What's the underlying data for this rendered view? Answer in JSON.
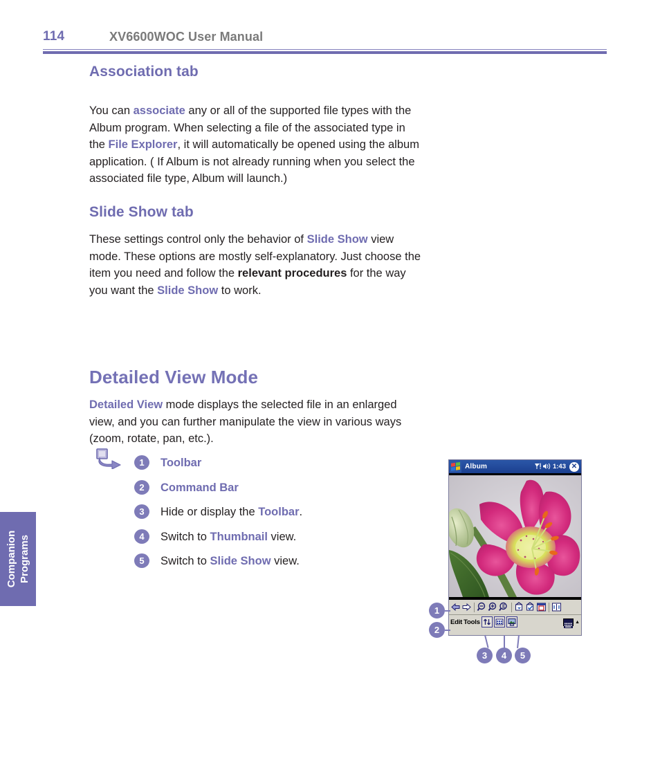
{
  "header": {
    "page_number": "114",
    "manual_title": "XV6600WOC User Manual"
  },
  "side_tab": {
    "line1": "Companion",
    "line2": "Programs"
  },
  "sections": {
    "association": {
      "heading": "Association tab",
      "paragraph": {
        "t1": "You can ",
        "hl1": "associate",
        "t2": " any or all of the supported file types with the Album program. When selecting a file of the associated type in the ",
        "hl2": "File Explorer",
        "t3": ", it will automatically be opened using the album application. ( If Album is not already running when you select the associated file type, Album will launch.)"
      }
    },
    "slide_show": {
      "heading": "Slide Show tab",
      "paragraph": {
        "t1": "These settings control only the behavior of ",
        "hl1": "Slide Show",
        "t2": " view mode. These options are mostly self-explanatory. Just choose the item you need and follow the ",
        "bk1": "relevant procedures",
        "t3": " for the way you want the ",
        "hl2": "Slide Show",
        "t4": " to work."
      }
    },
    "detailed_view": {
      "heading": "Detailed View Mode",
      "paragraph": {
        "hl1": "Detailed View",
        "t1": " mode displays the selected file in an enlarged view, and you can further manipulate the view in various ways (zoom, rotate, pan, etc.)."
      }
    }
  },
  "legend": [
    {
      "num": "1",
      "strong": true,
      "text": "Toolbar"
    },
    {
      "num": "2",
      "strong": true,
      "text": "Command Bar"
    },
    {
      "num": "3",
      "strong": false,
      "pre": "Hide or display the ",
      "hl": "Toolbar",
      "post": "."
    },
    {
      "num": "4",
      "strong": false,
      "pre": "Switch to ",
      "hl": "Thumbnail",
      "post": " view."
    },
    {
      "num": "5",
      "strong": false,
      "pre": "Switch to ",
      "hl": "Slide Show",
      "post": " view."
    }
  ],
  "pda": {
    "app_title": "Album",
    "signal_icon": "signal-icon",
    "speaker_icon": "speaker-icon",
    "clock": "1:43",
    "close_label": "✕",
    "start_icon": "windows-start-icon",
    "photo_alt": "pink-lily-flower-photo",
    "toolbar_icons": [
      "previous-arrow-icon",
      "next-arrow-icon",
      "zoom-out-icon",
      "zoom-in-icon",
      "fit-to-screen-icon",
      "rotate-left-icon",
      "rotate-right-icon",
      "crop-icon",
      "full-screen-icon"
    ],
    "menus": [
      "Edit",
      "Tools"
    ],
    "command_buttons": [
      "toggle-toolbar-icon",
      "thumbnail-view-icon",
      "slide-show-icon"
    ],
    "keyboard_icon": "soft-keyboard-icon",
    "input-arrow": "▲"
  },
  "callouts": [
    {
      "num": "1"
    },
    {
      "num": "2"
    },
    {
      "num": "3"
    },
    {
      "num": "4"
    },
    {
      "num": "5"
    }
  ],
  "colors": {
    "accent_purple": "#6f6cb0",
    "badge_purple": "#7e7bb8",
    "title_gray": "#7a7a7a",
    "body_black": "#231f20",
    "pda_titlebar_blue": "#1b3f8f",
    "pda_chrome": "#d8d6cd"
  }
}
